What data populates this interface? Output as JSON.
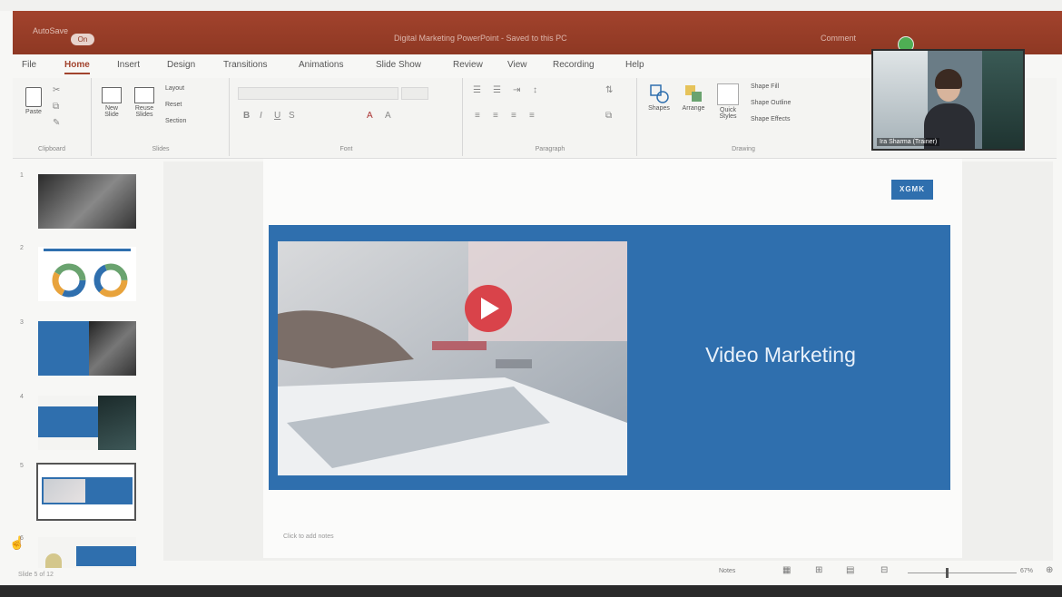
{
  "window": {
    "quick_access": "AutoSave",
    "autosave_state": "On",
    "doc_title": "Digital Marketing PowerPoint - Saved to this PC",
    "user": "Comment"
  },
  "menu": {
    "tabs": [
      "File",
      "Home",
      "Insert",
      "Design",
      "Transitions",
      "Animations",
      "Slide Show",
      "Review",
      "View",
      "Recording",
      "Help"
    ],
    "active": "Home"
  },
  "ribbon": {
    "clipboard": {
      "label": "Clipboard",
      "paste": "Paste"
    },
    "slides": {
      "label": "Slides",
      "new_slide": "New Slide",
      "reuse": "Reuse Slides",
      "layout": "Layout",
      "reset": "Reset",
      "section": "Section"
    },
    "font": {
      "label": "Font"
    },
    "paragraph": {
      "label": "Paragraph"
    },
    "drawing": {
      "label": "Drawing",
      "shapes": "Shapes",
      "arrange": "Arrange",
      "quick_styles": "Quick Styles",
      "shape_fill": "Shape Fill",
      "shape_outline": "Shape Outline",
      "shape_effects": "Shape Effects"
    }
  },
  "thumbnails": [
    {
      "number": "1"
    },
    {
      "number": "2"
    },
    {
      "number": "3"
    },
    {
      "number": "4"
    },
    {
      "number": "5",
      "selected": true
    },
    {
      "number": "6"
    }
  ],
  "slide": {
    "logo": "XGMK",
    "title": "Video Marketing",
    "notes_placeholder": "Click to add notes"
  },
  "status": {
    "slide_counter": "Slide 5 of 12",
    "notes": "Notes",
    "zoom": "67%"
  },
  "video_call": {
    "participant": "Ira Sharma (Trainer)"
  },
  "colors": {
    "title_bar": "#8e3823",
    "accent": "#a2432d",
    "slide_blue": "#2f6fae"
  }
}
